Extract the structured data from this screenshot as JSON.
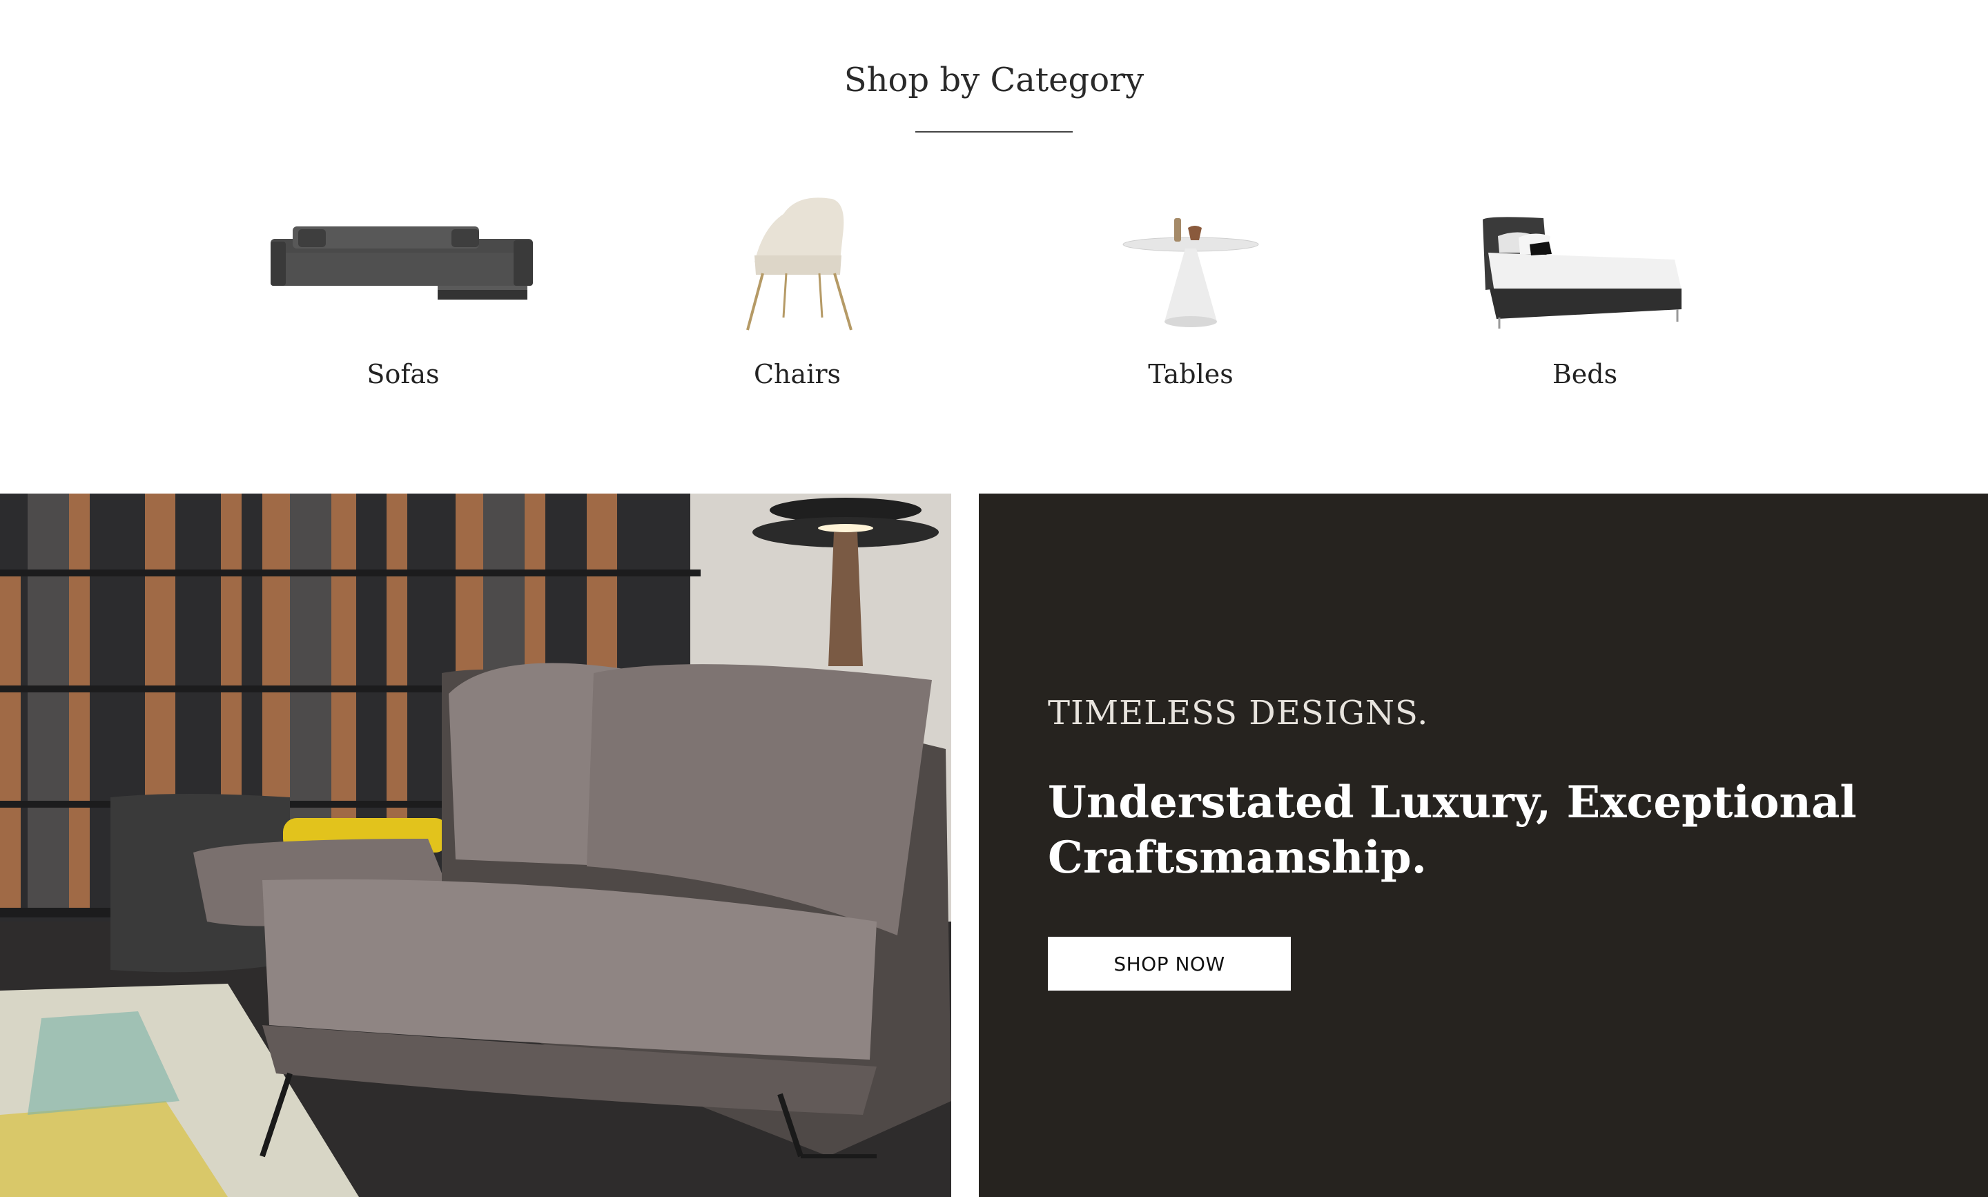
{
  "categories_section": {
    "title": "Shop by Category",
    "items": [
      {
        "label": "Sofas",
        "icon": "sofa-image"
      },
      {
        "label": "Chairs",
        "icon": "chair-image"
      },
      {
        "label": "Tables",
        "icon": "table-image"
      },
      {
        "label": "Beds",
        "icon": "bed-image"
      }
    ]
  },
  "promo": {
    "eyebrow": "TIMELESS DESIGNS.",
    "headline_line1": "Understated Luxury, Exceptional",
    "headline_line2": "Craftsmanship.",
    "button_label": "SHOP NOW",
    "background_color": "#26231f"
  },
  "hero_image": {
    "subject": "living-room-sofa-photo"
  }
}
